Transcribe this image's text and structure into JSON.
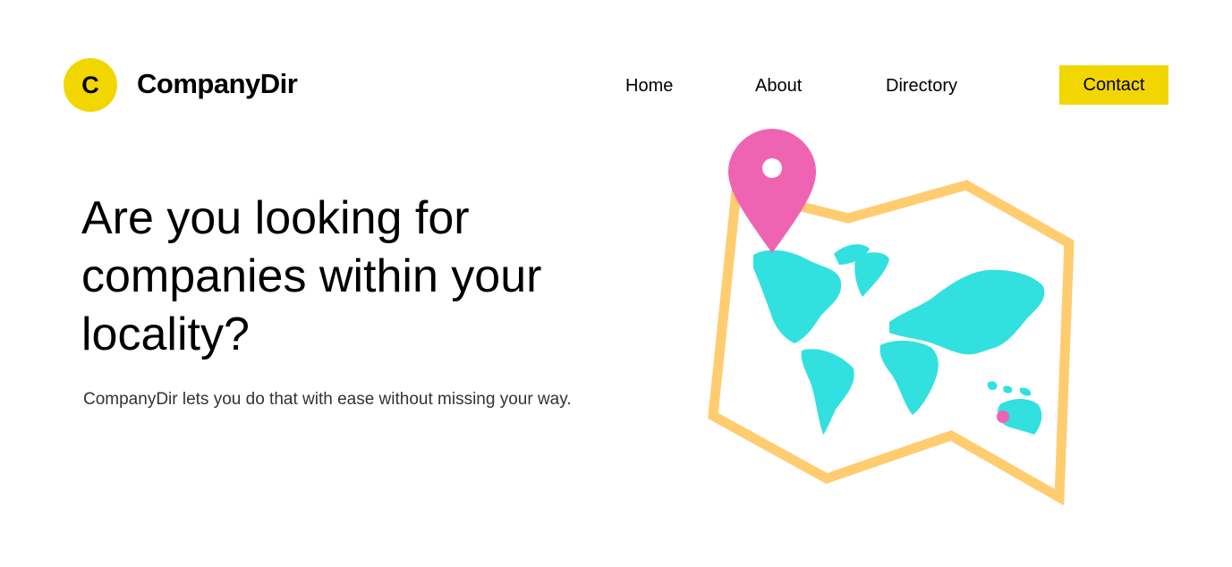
{
  "header": {
    "logo_letter": "C",
    "brand_name": "CompanyDir",
    "nav": [
      "Home",
      "About",
      "Directory"
    ],
    "contact_label": "Contact",
    "accent_color": "#f2d600"
  },
  "hero": {
    "title": "Are you looking for companies within your locality?",
    "subtitle": "CompanyDir lets you do that with ease without missing your way."
  },
  "illustration": {
    "icon": "world-map-with-location-pin",
    "map_border_color": "#ffcc70",
    "land_color": "#33e0e0",
    "pin_color": "#ef64b2"
  }
}
